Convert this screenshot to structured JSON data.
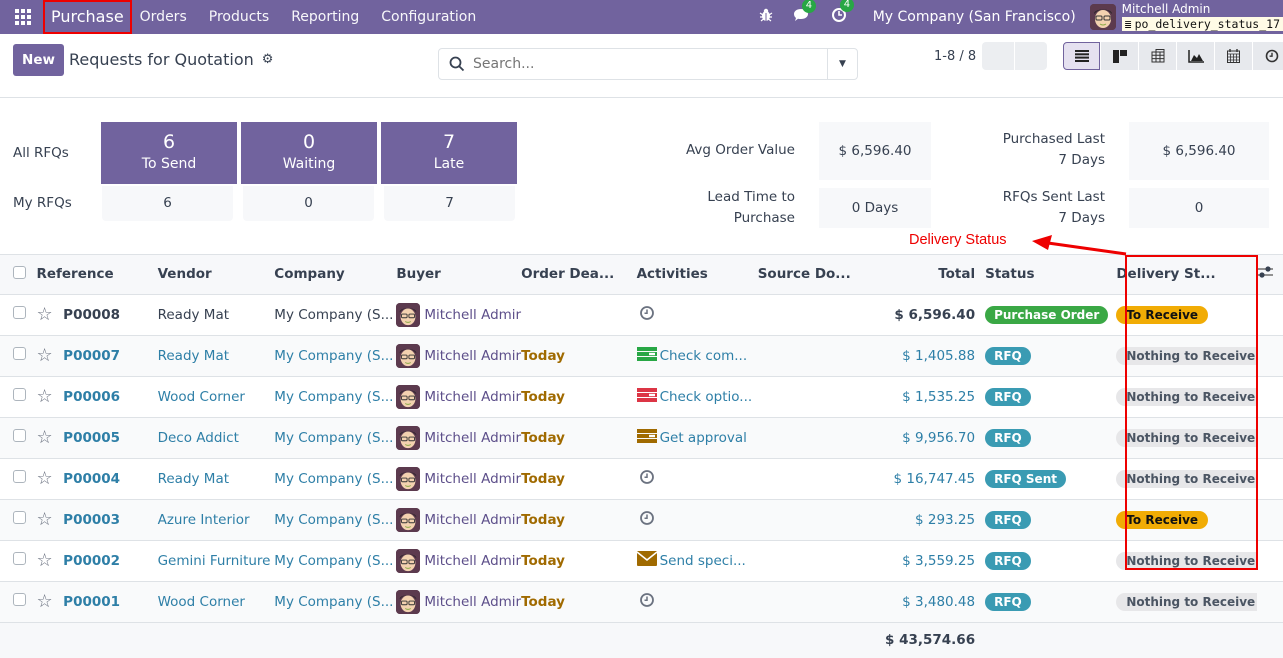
{
  "navbar": {
    "app_name": "Purchase",
    "menu": [
      "Orders",
      "Products",
      "Reporting",
      "Configuration"
    ],
    "messages_count": "4",
    "activities_count": "4",
    "company": "My Company (San Francisco)",
    "user_name": "Mitchell Admin",
    "database": "po_delivery_status_17"
  },
  "control": {
    "new_label": "New",
    "title": "Requests for Quotation",
    "search_placeholder": "Search...",
    "pager": "1-8 / 8",
    "views": [
      "list-view",
      "kanban-view",
      "pivot-view",
      "graph-view",
      "calendar-view",
      "activity-view"
    ]
  },
  "dashboard": {
    "all_rfqs_label": "All RFQs",
    "my_rfqs_label": "My RFQs",
    "tiles": [
      {
        "value": "6",
        "label": "To Send",
        "my": "6"
      },
      {
        "value": "0",
        "label": "Waiting",
        "my": "0"
      },
      {
        "value": "7",
        "label": "Late",
        "my": "7"
      }
    ],
    "stats": [
      {
        "label": "Avg Order Value",
        "value": "$ 6,596.40"
      },
      {
        "label": "Purchased Last 7 Days",
        "value": "$ 6,596.40"
      },
      {
        "label": "Lead Time to Purchase",
        "value": "0 Days"
      },
      {
        "label": "RFQs Sent Last 7 Days",
        "value": "0"
      }
    ]
  },
  "annotation": {
    "text": "Delivery Status",
    "color": "#ee0000"
  },
  "table": {
    "columns": [
      "Reference",
      "Vendor",
      "Company",
      "Buyer",
      "Order Dea...",
      "Activities",
      "Source Do...",
      "Total",
      "Status",
      "Delivery St..."
    ],
    "rows": [
      {
        "ref": "P00008",
        "vendor": "Ready Mat",
        "company": "My Company (S...",
        "buyer": "Mitchell Admir",
        "deadline": "",
        "activity": "",
        "activity_icon": "clock",
        "total": "$ 6,596.40",
        "status": "Purchase Order",
        "status_color": "green",
        "delivery": "To Receive",
        "delivery_kind": "warn",
        "confirmed": true
      },
      {
        "ref": "P00007",
        "vendor": "Ready Mat",
        "company": "My Company (S...",
        "buyer": "Mitchell Admir",
        "deadline": "Today",
        "activity": "Check com...",
        "activity_icon": "todo-green",
        "total": "$ 1,405.88",
        "status": "RFQ",
        "status_color": "blue",
        "delivery": "Nothing to Receive",
        "delivery_kind": "muted",
        "confirmed": false
      },
      {
        "ref": "P00006",
        "vendor": "Wood Corner",
        "company": "My Company (S...",
        "buyer": "Mitchell Admir",
        "deadline": "Today",
        "activity": "Check optio...",
        "activity_icon": "todo-red",
        "total": "$ 1,535.25",
        "status": "RFQ",
        "status_color": "blue",
        "delivery": "Nothing to Receive",
        "delivery_kind": "muted",
        "confirmed": false
      },
      {
        "ref": "P00005",
        "vendor": "Deco Addict",
        "company": "My Company (S...",
        "buyer": "Mitchell Admir",
        "deadline": "Today",
        "activity": "Get approval",
        "activity_icon": "todo-brown",
        "total": "$ 9,956.70",
        "status": "RFQ",
        "status_color": "blue",
        "delivery": "Nothing to Receive",
        "delivery_kind": "muted",
        "confirmed": false
      },
      {
        "ref": "P00004",
        "vendor": "Ready Mat",
        "company": "My Company (S...",
        "buyer": "Mitchell Admir",
        "deadline": "Today",
        "activity": "",
        "activity_icon": "clock",
        "total": "$ 16,747.45",
        "status": "RFQ Sent",
        "status_color": "blue",
        "delivery": "Nothing to Receive",
        "delivery_kind": "muted",
        "confirmed": false
      },
      {
        "ref": "P00003",
        "vendor": "Azure Interior",
        "company": "My Company (S...",
        "buyer": "Mitchell Admir",
        "deadline": "Today",
        "activity": "",
        "activity_icon": "clock",
        "total": "$ 293.25",
        "status": "RFQ",
        "status_color": "blue",
        "delivery": "To Receive",
        "delivery_kind": "warn",
        "confirmed": false
      },
      {
        "ref": "P00002",
        "vendor": "Gemini Furniture",
        "company": "My Company (S...",
        "buyer": "Mitchell Admir",
        "deadline": "Today",
        "activity": "Send speci...",
        "activity_icon": "email",
        "total": "$ 3,559.25",
        "status": "RFQ",
        "status_color": "blue",
        "delivery": "Nothing to Receive",
        "delivery_kind": "muted",
        "confirmed": false
      },
      {
        "ref": "P00001",
        "vendor": "Wood Corner",
        "company": "My Company (S...",
        "buyer": "Mitchell Admir",
        "deadline": "Today",
        "activity": "",
        "activity_icon": "clock",
        "total": "$ 3,480.48",
        "status": "RFQ",
        "status_color": "blue",
        "delivery": "Nothing to Receive",
        "delivery_kind": "muted",
        "confirmed": false
      }
    ],
    "grand_total": "$ 43,574.66"
  },
  "colors": {
    "brand": "#71639e",
    "link": "#2e7fa7",
    "green": "#3aa845",
    "blue": "#3a9bb3",
    "warning": "#f1ac05",
    "today": "#a06a00"
  }
}
